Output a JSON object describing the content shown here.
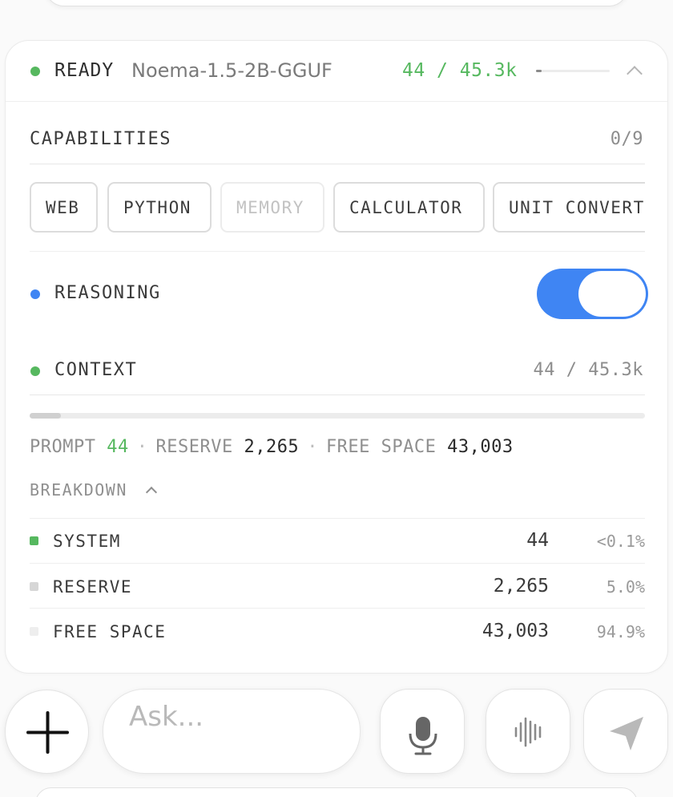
{
  "header": {
    "status": "READY",
    "status_color": "#56b85f",
    "model_name": "Noema-1.5-2B-GGUF",
    "context_usage": "44 / 45.3k",
    "usage_fraction": 0.001,
    "collapse_icon": "chevron-up-icon"
  },
  "capabilities": {
    "title": "CAPABILITIES",
    "count": "0/9",
    "chips": [
      {
        "label": "WEB",
        "enabled": true
      },
      {
        "label": "PYTHON",
        "enabled": true
      },
      {
        "label": "MEMORY",
        "enabled": false
      },
      {
        "label": "CALCULATOR",
        "enabled": true
      },
      {
        "label": "UNIT CONVERTER",
        "enabled": true
      }
    ]
  },
  "reasoning": {
    "label": "REASONING",
    "dot_color": "#3f85f3",
    "enabled": true
  },
  "context": {
    "label": "CONTEXT",
    "dot_color": "#56b85f",
    "usage": "44 / 45.3k",
    "used_fraction": 0.051,
    "summary": {
      "prompt_label": "PROMPT",
      "prompt_value": "44",
      "separator": "·",
      "reserve_label": "RESERVE",
      "reserve_value": "2,265",
      "free_label": "FREE SPACE",
      "free_value": "43,003"
    },
    "breakdown_label": "BREAKDOWN",
    "breakdown": [
      {
        "label": "SYSTEM",
        "value": "44",
        "pct": "<0.1%",
        "color": "#56b85f"
      },
      {
        "label": "RESERVE",
        "value": "2,265",
        "pct": "5.0%",
        "color": "#d6d6d6"
      },
      {
        "label": "FREE SPACE",
        "value": "43,003",
        "pct": "94.9%",
        "color": "#eeeeee"
      }
    ]
  },
  "composer": {
    "add_icon": "plus-icon",
    "placeholder": "Ask...",
    "mic_icon": "microphone-icon",
    "voice_icon": "waveform-icon",
    "send_icon": "send-icon"
  }
}
